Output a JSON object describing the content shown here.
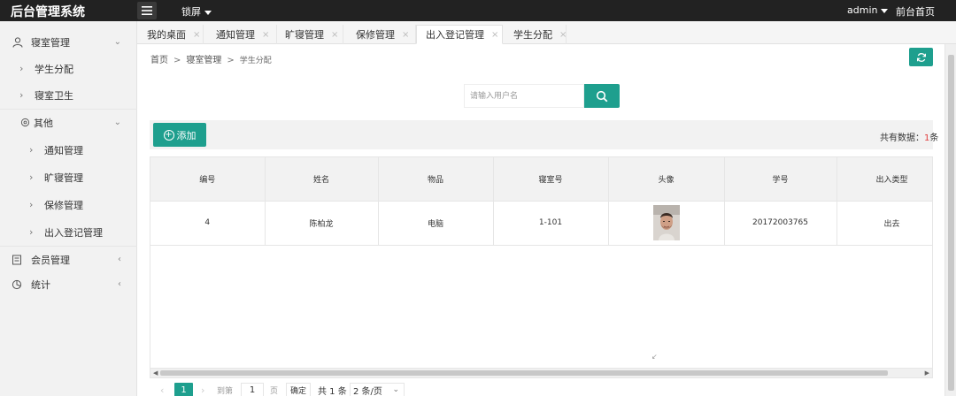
{
  "app": {
    "title": "后台管理系统"
  },
  "header": {
    "lock_label": "锁屏",
    "user_label": "admin",
    "front_label": "前台首页"
  },
  "sidebar": {
    "groups": [
      {
        "label": "寝室管理",
        "icon": "user-icon",
        "items": [
          "学生分配",
          "寝室卫生"
        ]
      },
      {
        "label": "其他",
        "icon": "settings-icon",
        "items": [
          "通知管理",
          "旷寝管理",
          "保修管理",
          "出入登记管理"
        ]
      },
      {
        "label": "会员管理",
        "icon": "member-icon",
        "items": []
      },
      {
        "label": "统计",
        "icon": "chart-icon",
        "items": []
      }
    ]
  },
  "tabs": [
    {
      "label": "我的桌面",
      "close": "×",
      "active": false
    },
    {
      "label": "通知管理",
      "close": "×",
      "active": false
    },
    {
      "label": "旷寝管理",
      "close": "×",
      "active": false
    },
    {
      "label": "保修管理",
      "close": "×",
      "active": false
    },
    {
      "label": "出入登记管理",
      "close": "×",
      "active": true
    },
    {
      "label": "学生分配",
      "close": "×",
      "active": false
    }
  ],
  "breadcrumb": {
    "home": "首页",
    "section": "寝室管理",
    "current": "学生分配"
  },
  "search": {
    "placeholder": "请输入用户名",
    "value": ""
  },
  "toolbar": {
    "add_label": "添加",
    "total_label": "共有数据：",
    "total_value": "1",
    "total_unit": "条"
  },
  "table": {
    "columns": [
      "编号",
      "姓名",
      "物品",
      "寝室号",
      "头像",
      "学号",
      "出入类型"
    ],
    "rows": [
      {
        "id": "4",
        "name": "陈柏龙",
        "item": "电脑",
        "room": "1-101",
        "avatar": "avatar-photo",
        "student_no": "20172003765",
        "type": "出去"
      }
    ]
  },
  "pager": {
    "current": "1",
    "goto_label": "到第",
    "goto_value": "1",
    "page_unit": "页",
    "confirm_label": "确定",
    "total_label": "共 1 条",
    "size_label": "2 条/页"
  },
  "colors": {
    "accent": "#1e9f8e",
    "topbar": "#222222",
    "sidebar": "#f2f2f2"
  }
}
